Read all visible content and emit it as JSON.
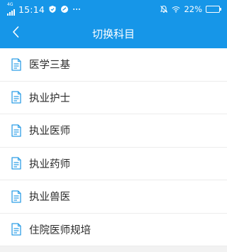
{
  "status_bar": {
    "network_type": "4G",
    "time": "15:14",
    "battery_percent": "22%",
    "battery_level": 0.22,
    "icons": [
      "signal-icon",
      "shield-icon",
      "bubble-icon",
      "ellipsis-icon",
      "mute-icon",
      "wifi-icon",
      "battery-icon"
    ]
  },
  "header": {
    "title": "切换科目",
    "back_icon": "chevron-left-icon",
    "background": "#1696e8"
  },
  "subjects": [
    {
      "label": "医学三基",
      "icon": "document-icon"
    },
    {
      "label": "执业护士",
      "icon": "document-icon"
    },
    {
      "label": "执业医师",
      "icon": "document-icon"
    },
    {
      "label": "执业药师",
      "icon": "document-icon"
    },
    {
      "label": "执业兽医",
      "icon": "document-icon"
    },
    {
      "label": "住院医师规培",
      "icon": "document-icon"
    }
  ],
  "colors": {
    "accent": "#1696e8",
    "icon": "#2f9fe6",
    "text": "#2b2b2b",
    "divider": "#ececec"
  }
}
